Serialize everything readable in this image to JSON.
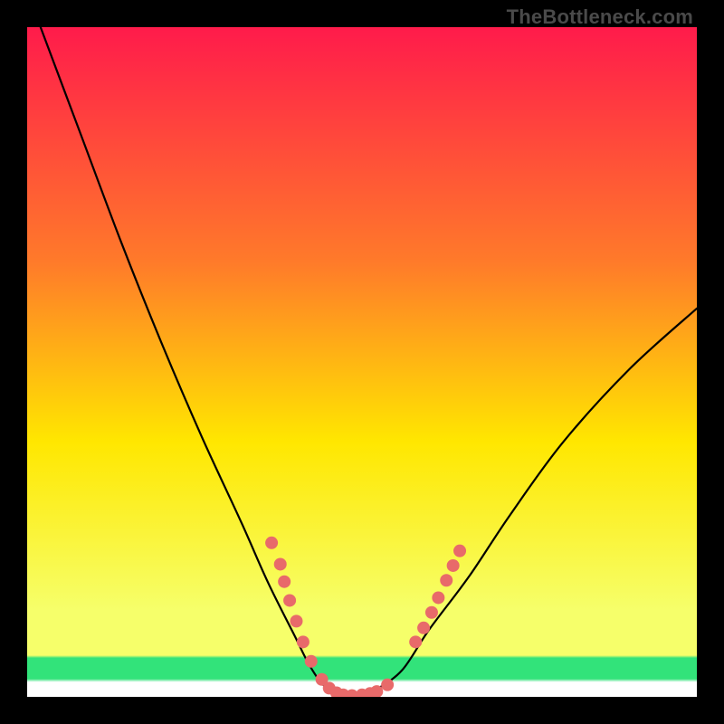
{
  "watermark": "TheBottleneck.com",
  "chart_data": {
    "type": "line",
    "title": "",
    "xlabel": "",
    "ylabel": "",
    "xlim": [
      0,
      100
    ],
    "ylim": [
      0,
      100
    ],
    "grid": false,
    "legend": false,
    "gradient_colors": {
      "top": "#ff1b4b",
      "upper_mid": "#ff7a2a",
      "mid": "#ffe700",
      "lower_mid": "#f6ff6a",
      "green_band": "#32e37a",
      "bottom": "#ffffff"
    },
    "curve": {
      "comment": "Black V-shaped bottleneck curve. x in [0,100], y in [0,100]; y=0 is bottom (minimum).",
      "x": [
        2,
        8,
        14,
        20,
        26,
        32,
        36,
        40,
        42,
        44,
        46,
        48,
        50,
        52,
        56,
        60,
        66,
        72,
        80,
        90,
        100
      ],
      "y": [
        100,
        84,
        68,
        53,
        39,
        26,
        17,
        9,
        5,
        2,
        0.5,
        0,
        0,
        1,
        4,
        10,
        18,
        27,
        38,
        49,
        58
      ]
    },
    "markers": {
      "comment": "Salmon dots/segments clustered near curve minimum on both branches and along floor.",
      "points": [
        {
          "x": 36.5,
          "y": 23.0
        },
        {
          "x": 37.8,
          "y": 19.8
        },
        {
          "x": 38.4,
          "y": 17.2
        },
        {
          "x": 39.2,
          "y": 14.4
        },
        {
          "x": 40.2,
          "y": 11.3
        },
        {
          "x": 41.2,
          "y": 8.2
        },
        {
          "x": 42.4,
          "y": 5.3
        },
        {
          "x": 44.0,
          "y": 2.6
        },
        {
          "x": 45.1,
          "y": 1.3
        },
        {
          "x": 46.2,
          "y": 0.6
        },
        {
          "x": 47.2,
          "y": 0.3
        },
        {
          "x": 48.5,
          "y": 0.2
        },
        {
          "x": 50.0,
          "y": 0.3
        },
        {
          "x": 51.2,
          "y": 0.5
        },
        {
          "x": 52.2,
          "y": 0.8
        },
        {
          "x": 53.8,
          "y": 1.8
        },
        {
          "x": 58.0,
          "y": 8.2
        },
        {
          "x": 59.2,
          "y": 10.3
        },
        {
          "x": 60.4,
          "y": 12.6
        },
        {
          "x": 61.4,
          "y": 14.8
        },
        {
          "x": 62.6,
          "y": 17.4
        },
        {
          "x": 63.6,
          "y": 19.6
        },
        {
          "x": 64.6,
          "y": 21.8
        }
      ],
      "color": "#e86a6a",
      "radius_px": 7
    }
  }
}
